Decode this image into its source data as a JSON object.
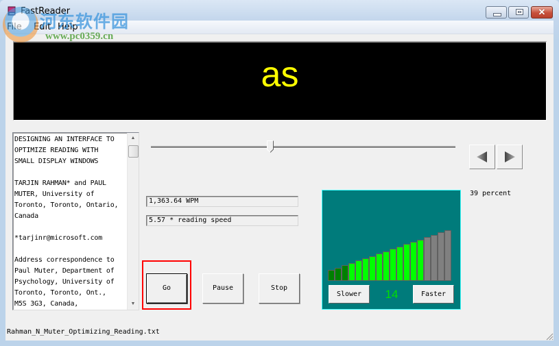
{
  "window": {
    "title": "FastReader",
    "controls": {
      "minimize": "minimize",
      "maximize": "maximize",
      "close": "close"
    }
  },
  "menu": {
    "items": [
      {
        "label": "File"
      },
      {
        "label": "Edit"
      },
      {
        "label": "Help"
      }
    ]
  },
  "display": {
    "current_word": "as",
    "text_color": "#ffff00",
    "background": "#000000"
  },
  "document": {
    "text": "DESIGNING AN INTERFACE TO\nOPTIMIZE READING WITH\nSMALL DISPLAY WINDOWS\n\nTARJIN RAHMAN* and PAUL\nMUTER, University of\nToronto, Toronto, Ontario,\nCanada\n\n*tarjinr@microsoft.com\n\nAddress correspondence to\nPaul Muter, Department of\nPsychology, University of\nToronto, Toronto, Ont.,\nM5S 3G3, Canada,"
  },
  "position": {
    "percent_label": "39 percent",
    "progress_fraction": 0.39
  },
  "navigation": {
    "prev_icon": "left-triangle",
    "next_icon": "right-triangle"
  },
  "readouts": {
    "wpm": "1,363.64 WPM",
    "speed_multiplier": "5.57 * reading speed"
  },
  "controls": {
    "go": "Go",
    "pause": "Pause",
    "stop": "Stop"
  },
  "speed_panel": {
    "level": "14",
    "slower": "Slower",
    "faster": "Faster",
    "total_bars": 18,
    "active_bars": 14,
    "dim_active_bars": 3,
    "colors": {
      "dim_green": "#008000",
      "bright_green": "#00ff00",
      "inactive": "#808080",
      "panel": "#007b7b",
      "level_text": "#00e000"
    }
  },
  "status": {
    "filename": "Rahman_N_Muter_Optimizing_Reading.txt"
  },
  "watermark": {
    "site_name": "河东软件园",
    "url": "www.pc0359.cn"
  },
  "highlight": {
    "color": "#ff0000",
    "target": "go"
  }
}
